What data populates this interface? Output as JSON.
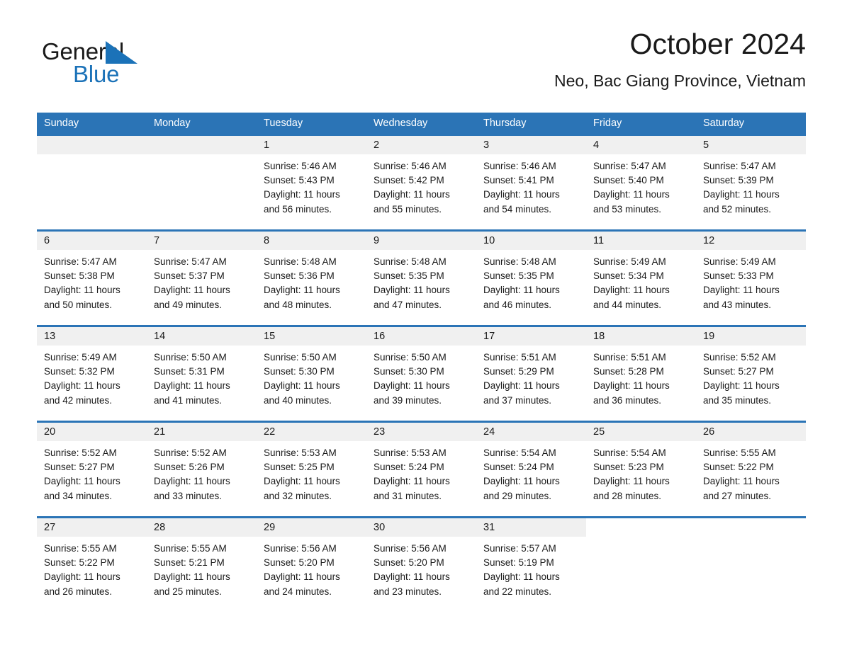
{
  "brand": {
    "name_top": "General",
    "name_bottom": "Blue",
    "accent_color": "#1b72b8"
  },
  "header": {
    "title": "October 2024",
    "location": "Neo, Bac Giang Province, Vietnam"
  },
  "theme": {
    "header_row_color": "#2b74b6",
    "date_band_color": "#f0f0f0",
    "cell_background": "#ffffff",
    "text_color": "#1a1a1a"
  },
  "weekdays": [
    "Sunday",
    "Monday",
    "Tuesday",
    "Wednesday",
    "Thursday",
    "Friday",
    "Saturday"
  ],
  "weeks": [
    [
      {
        "day": "",
        "blank": true,
        "band": true
      },
      {
        "day": "",
        "blank": true,
        "band": true
      },
      {
        "day": "1",
        "sunrise": "Sunrise: 5:46 AM",
        "sunset": "Sunset: 5:43 PM",
        "daylight1": "Daylight: 11 hours",
        "daylight2": "and 56 minutes."
      },
      {
        "day": "2",
        "sunrise": "Sunrise: 5:46 AM",
        "sunset": "Sunset: 5:42 PM",
        "daylight1": "Daylight: 11 hours",
        "daylight2": "and 55 minutes."
      },
      {
        "day": "3",
        "sunrise": "Sunrise: 5:46 AM",
        "sunset": "Sunset: 5:41 PM",
        "daylight1": "Daylight: 11 hours",
        "daylight2": "and 54 minutes."
      },
      {
        "day": "4",
        "sunrise": "Sunrise: 5:47 AM",
        "sunset": "Sunset: 5:40 PM",
        "daylight1": "Daylight: 11 hours",
        "daylight2": "and 53 minutes."
      },
      {
        "day": "5",
        "sunrise": "Sunrise: 5:47 AM",
        "sunset": "Sunset: 5:39 PM",
        "daylight1": "Daylight: 11 hours",
        "daylight2": "and 52 minutes."
      }
    ],
    [
      {
        "day": "6",
        "sunrise": "Sunrise: 5:47 AM",
        "sunset": "Sunset: 5:38 PM",
        "daylight1": "Daylight: 11 hours",
        "daylight2": "and 50 minutes."
      },
      {
        "day": "7",
        "sunrise": "Sunrise: 5:47 AM",
        "sunset": "Sunset: 5:37 PM",
        "daylight1": "Daylight: 11 hours",
        "daylight2": "and 49 minutes."
      },
      {
        "day": "8",
        "sunrise": "Sunrise: 5:48 AM",
        "sunset": "Sunset: 5:36 PM",
        "daylight1": "Daylight: 11 hours",
        "daylight2": "and 48 minutes."
      },
      {
        "day": "9",
        "sunrise": "Sunrise: 5:48 AM",
        "sunset": "Sunset: 5:35 PM",
        "daylight1": "Daylight: 11 hours",
        "daylight2": "and 47 minutes."
      },
      {
        "day": "10",
        "sunrise": "Sunrise: 5:48 AM",
        "sunset": "Sunset: 5:35 PM",
        "daylight1": "Daylight: 11 hours",
        "daylight2": "and 46 minutes."
      },
      {
        "day": "11",
        "sunrise": "Sunrise: 5:49 AM",
        "sunset": "Sunset: 5:34 PM",
        "daylight1": "Daylight: 11 hours",
        "daylight2": "and 44 minutes."
      },
      {
        "day": "12",
        "sunrise": "Sunrise: 5:49 AM",
        "sunset": "Sunset: 5:33 PM",
        "daylight1": "Daylight: 11 hours",
        "daylight2": "and 43 minutes."
      }
    ],
    [
      {
        "day": "13",
        "sunrise": "Sunrise: 5:49 AM",
        "sunset": "Sunset: 5:32 PM",
        "daylight1": "Daylight: 11 hours",
        "daylight2": "and 42 minutes."
      },
      {
        "day": "14",
        "sunrise": "Sunrise: 5:50 AM",
        "sunset": "Sunset: 5:31 PM",
        "daylight1": "Daylight: 11 hours",
        "daylight2": "and 41 minutes."
      },
      {
        "day": "15",
        "sunrise": "Sunrise: 5:50 AM",
        "sunset": "Sunset: 5:30 PM",
        "daylight1": "Daylight: 11 hours",
        "daylight2": "and 40 minutes."
      },
      {
        "day": "16",
        "sunrise": "Sunrise: 5:50 AM",
        "sunset": "Sunset: 5:30 PM",
        "daylight1": "Daylight: 11 hours",
        "daylight2": "and 39 minutes."
      },
      {
        "day": "17",
        "sunrise": "Sunrise: 5:51 AM",
        "sunset": "Sunset: 5:29 PM",
        "daylight1": "Daylight: 11 hours",
        "daylight2": "and 37 minutes."
      },
      {
        "day": "18",
        "sunrise": "Sunrise: 5:51 AM",
        "sunset": "Sunset: 5:28 PM",
        "daylight1": "Daylight: 11 hours",
        "daylight2": "and 36 minutes."
      },
      {
        "day": "19",
        "sunrise": "Sunrise: 5:52 AM",
        "sunset": "Sunset: 5:27 PM",
        "daylight1": "Daylight: 11 hours",
        "daylight2": "and 35 minutes."
      }
    ],
    [
      {
        "day": "20",
        "sunrise": "Sunrise: 5:52 AM",
        "sunset": "Sunset: 5:27 PM",
        "daylight1": "Daylight: 11 hours",
        "daylight2": "and 34 minutes."
      },
      {
        "day": "21",
        "sunrise": "Sunrise: 5:52 AM",
        "sunset": "Sunset: 5:26 PM",
        "daylight1": "Daylight: 11 hours",
        "daylight2": "and 33 minutes."
      },
      {
        "day": "22",
        "sunrise": "Sunrise: 5:53 AM",
        "sunset": "Sunset: 5:25 PM",
        "daylight1": "Daylight: 11 hours",
        "daylight2": "and 32 minutes."
      },
      {
        "day": "23",
        "sunrise": "Sunrise: 5:53 AM",
        "sunset": "Sunset: 5:24 PM",
        "daylight1": "Daylight: 11 hours",
        "daylight2": "and 31 minutes."
      },
      {
        "day": "24",
        "sunrise": "Sunrise: 5:54 AM",
        "sunset": "Sunset: 5:24 PM",
        "daylight1": "Daylight: 11 hours",
        "daylight2": "and 29 minutes."
      },
      {
        "day": "25",
        "sunrise": "Sunrise: 5:54 AM",
        "sunset": "Sunset: 5:23 PM",
        "daylight1": "Daylight: 11 hours",
        "daylight2": "and 28 minutes."
      },
      {
        "day": "26",
        "sunrise": "Sunrise: 5:55 AM",
        "sunset": "Sunset: 5:22 PM",
        "daylight1": "Daylight: 11 hours",
        "daylight2": "and 27 minutes."
      }
    ],
    [
      {
        "day": "27",
        "sunrise": "Sunrise: 5:55 AM",
        "sunset": "Sunset: 5:22 PM",
        "daylight1": "Daylight: 11 hours",
        "daylight2": "and 26 minutes."
      },
      {
        "day": "28",
        "sunrise": "Sunrise: 5:55 AM",
        "sunset": "Sunset: 5:21 PM",
        "daylight1": "Daylight: 11 hours",
        "daylight2": "and 25 minutes."
      },
      {
        "day": "29",
        "sunrise": "Sunrise: 5:56 AM",
        "sunset": "Sunset: 5:20 PM",
        "daylight1": "Daylight: 11 hours",
        "daylight2": "and 24 minutes."
      },
      {
        "day": "30",
        "sunrise": "Sunrise: 5:56 AM",
        "sunset": "Sunset: 5:20 PM",
        "daylight1": "Daylight: 11 hours",
        "daylight2": "and 23 minutes."
      },
      {
        "day": "31",
        "sunrise": "Sunrise: 5:57 AM",
        "sunset": "Sunset: 5:19 PM",
        "daylight1": "Daylight: 11 hours",
        "daylight2": "and 22 minutes."
      },
      {
        "day": "",
        "blank": true,
        "band": false
      },
      {
        "day": "",
        "blank": true,
        "band": false
      }
    ]
  ]
}
